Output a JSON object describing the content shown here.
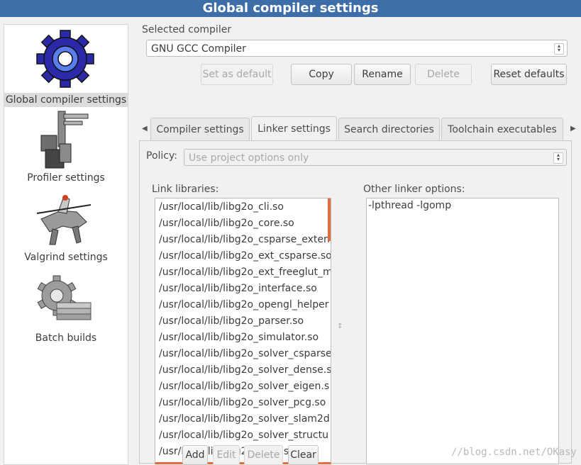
{
  "window": {
    "title": "Global compiler settings"
  },
  "sidebar": {
    "items": [
      {
        "label": "Global compiler settings",
        "icon": "gear-icon",
        "active": true
      },
      {
        "label": "Profiler settings",
        "icon": "caliper-icon",
        "active": false
      },
      {
        "label": "Valgrind settings",
        "icon": "knight-icon",
        "active": false
      },
      {
        "label": "Batch builds",
        "icon": "gear-stack-icon",
        "active": false
      }
    ]
  },
  "compiler": {
    "group_label": "Selected compiler",
    "selected": "GNU GCC Compiler",
    "buttons": {
      "set_default": "Set as default",
      "copy": "Copy",
      "rename": "Rename",
      "delete": "Delete",
      "reset": "Reset defaults"
    }
  },
  "tabs": [
    {
      "label": "Compiler settings",
      "active": false
    },
    {
      "label": "Linker settings",
      "active": true
    },
    {
      "label": "Search directories",
      "active": false
    },
    {
      "label": "Toolchain executables",
      "active": false
    }
  ],
  "linker": {
    "policy_label": "Policy:",
    "policy_value": "Use project options only",
    "libs_label": "Link libraries:",
    "other_label": "Other linker options:",
    "other_value": "-lpthread -lgomp",
    "libraries": [
      "/usr/local/lib/libg2o_cli.so",
      "/usr/local/lib/libg2o_core.so",
      "/usr/local/lib/libg2o_csparse_exten",
      "/usr/local/lib/libg2o_ext_csparse.so",
      "/usr/local/lib/libg2o_ext_freeglut_m",
      "/usr/local/lib/libg2o_interface.so",
      "/usr/local/lib/libg2o_opengl_helper",
      "/usr/local/lib/libg2o_parser.so",
      "/usr/local/lib/libg2o_simulator.so",
      "/usr/local/lib/libg2o_solver_csparse",
      "/usr/local/lib/libg2o_solver_dense.s",
      "/usr/local/lib/libg2o_solver_eigen.s",
      "/usr/local/lib/libg2o_solver_pcg.so",
      "/usr/local/lib/libg2o_solver_slam2d",
      "/usr/local/lib/libg2o_solver_structu",
      "/usr/local/lib/libg2o_stuff.so"
    ],
    "lib_buttons": {
      "add": "Add",
      "edit": "Edit",
      "delete": "Delete",
      "clear": "Clear"
    }
  },
  "watermark": "//blog.csdn.net/OKasy"
}
